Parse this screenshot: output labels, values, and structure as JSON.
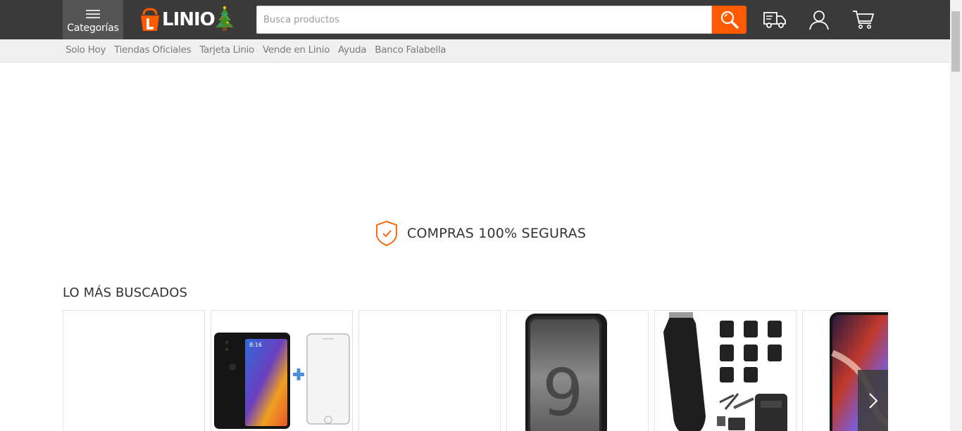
{
  "header": {
    "categories_label": "Categorías",
    "logo_text": "LINIO",
    "search_placeholder": "Busca productos",
    "search_value": "",
    "icons": [
      "hamburger-menu-icon",
      "linio-logo-icon",
      "christmas-tree-icon",
      "search-icon",
      "delivery-truck-icon",
      "user-account-icon",
      "shopping-cart-icon"
    ]
  },
  "subnav": {
    "items": [
      "Solo Hoy",
      "Tiendas Oficiales",
      "Tarjeta Linio",
      "Vende en Linio",
      "Ayuda",
      "Banco Falabella"
    ]
  },
  "secure_banner": {
    "text": "COMPRAS 100% SEGURAS",
    "icon": "shield-check-icon"
  },
  "most_searched": {
    "title": "LO MÁS BUSCADOS",
    "products": [
      {
        "image": "empty"
      },
      {
        "image": "smartphone-with-screen-protector"
      },
      {
        "image": "empty"
      },
      {
        "image": "samsung-galaxy-s9"
      },
      {
        "image": "hair-clipper-kit"
      },
      {
        "image": "smartphone-note"
      }
    ],
    "next_icon": "chevron-right-icon"
  },
  "colors": {
    "topbar": "#3a3a3a",
    "accent": "#ff5a00",
    "subnav_bg": "#f0f0f0",
    "subnav_text": "#7a7a7a"
  }
}
